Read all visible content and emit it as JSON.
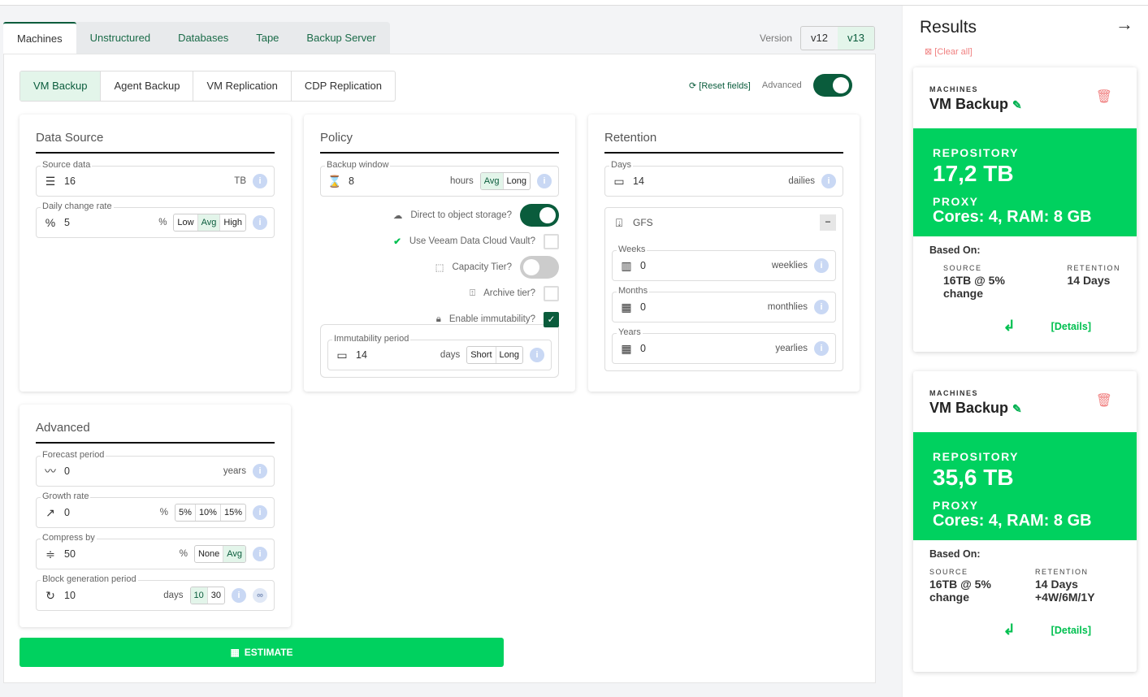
{
  "tabs": [
    "Machines",
    "Unstructured",
    "Databases",
    "Tape",
    "Backup Server"
  ],
  "version": {
    "label": "Version",
    "options": [
      "v12",
      "v13"
    ],
    "selected": "v13"
  },
  "subtabs": [
    "VM Backup",
    "Agent Backup",
    "VM Replication",
    "CDP Replication"
  ],
  "toolbar": {
    "reset": "[Reset fields]",
    "advanced": "Advanced",
    "advanced_on": true
  },
  "data_source": {
    "title": "Data Source",
    "source": {
      "label": "Source data",
      "value": "16",
      "unit": "TB"
    },
    "change": {
      "label": "Daily change rate",
      "value": "5",
      "unit": "%",
      "options": [
        "Low",
        "Avg",
        "High"
      ],
      "selected": "Avg"
    }
  },
  "policy": {
    "title": "Policy",
    "window": {
      "label": "Backup window",
      "value": "8",
      "unit": "hours",
      "options": [
        "Avg",
        "Long"
      ],
      "selected": "Avg"
    },
    "direct": {
      "label": "Direct to object storage?",
      "on": true
    },
    "vault": {
      "label": "Use Veeam Data Cloud Vault?",
      "checked": false
    },
    "capacity": {
      "label": "Capacity Tier?",
      "on": false
    },
    "archive": {
      "label": "Archive tier?",
      "checked": false
    },
    "immutability": {
      "label": "Enable immutability?",
      "checked": true
    },
    "imm_period": {
      "label": "Immutability period",
      "value": "14",
      "unit": "days",
      "options": [
        "Short",
        "Long"
      ]
    }
  },
  "retention": {
    "title": "Retention",
    "days": {
      "label": "Days",
      "value": "14",
      "unit": "dailies"
    },
    "gfs": "GFS",
    "weeks": {
      "label": "Weeks",
      "value": "0",
      "unit": "weeklies"
    },
    "months": {
      "label": "Months",
      "value": "0",
      "unit": "monthlies"
    },
    "years": {
      "label": "Years",
      "value": "0",
      "unit": "yearlies"
    }
  },
  "advanced": {
    "title": "Advanced",
    "forecast": {
      "label": "Forecast period",
      "value": "0",
      "unit": "years"
    },
    "growth": {
      "label": "Growth rate",
      "value": "0",
      "unit": "%",
      "options": [
        "5%",
        "10%",
        "15%"
      ]
    },
    "compress": {
      "label": "Compress by",
      "value": "50",
      "unit": "%",
      "options": [
        "None",
        "Avg"
      ],
      "selected": "Avg"
    },
    "block": {
      "label": "Block generation period",
      "value": "10",
      "unit": "days",
      "options": [
        "10",
        "30"
      ],
      "selected": "10"
    }
  },
  "estimate": "ESTIMATE",
  "results": {
    "title": "Results",
    "clear": "[Clear all]",
    "cards": [
      {
        "category": "MACHINES",
        "name": "VM Backup",
        "repo_label": "REPOSITORY",
        "repo": "17,2 TB",
        "proxy_label": "PROXY",
        "proxy": "Cores: 4, RAM: 8 GB",
        "based": "Based On:",
        "source_label": "SOURCE",
        "source": "16TB @ 5% change",
        "retention_label": "RETENTION",
        "retention": "14 Days",
        "details": "[Details]"
      },
      {
        "category": "MACHINES",
        "name": "VM Backup",
        "repo_label": "REPOSITORY",
        "repo": "35,6 TB",
        "proxy_label": "PROXY",
        "proxy": "Cores: 4, RAM: 8 GB",
        "based": "Based On:",
        "source_label": "SOURCE",
        "source": "16TB @ 5% change",
        "retention_label": "RETENTION",
        "retention": "14 Days +4W/6M/1Y",
        "details": "[Details]"
      }
    ]
  },
  "colors": {
    "accent": "#0a5c3c",
    "green": "#00d15f",
    "info": "#c9d8f4",
    "danger": "#f08080"
  }
}
